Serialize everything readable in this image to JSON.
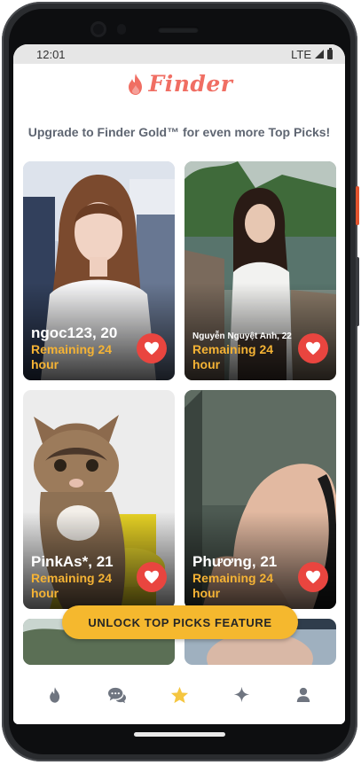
{
  "status_bar": {
    "time": "12:01",
    "network": "LTE"
  },
  "app": {
    "name": "Finder",
    "accent_color": "#f06e63"
  },
  "promo_text": "Upgrade to Finder Gold™ for even more Top Picks!",
  "cards": [
    {
      "name": "ngoc123, 20",
      "remaining": "Remaining 24 hour"
    },
    {
      "name": "Nguyễn Nguyệt Anh, 22",
      "remaining": "Remaining 24 hour"
    },
    {
      "name": "PinkAs*, 21",
      "remaining": "Remaining 24 hour"
    },
    {
      "name": "Phương, 21",
      "remaining": "Remaining 24 hour"
    }
  ],
  "unlock_button": {
    "label": "UNLOCK TOP PICKS FEATURE",
    "color": "#f5b82e"
  },
  "bottom_nav": {
    "items": [
      {
        "icon": "flame-icon",
        "active": false
      },
      {
        "icon": "chat-icon",
        "active": false
      },
      {
        "icon": "star-icon",
        "active": true
      },
      {
        "icon": "sparkle-icon",
        "active": false
      },
      {
        "icon": "profile-icon",
        "active": false
      }
    ],
    "active_color": "#f5c640",
    "inactive_color": "#6f7580"
  }
}
